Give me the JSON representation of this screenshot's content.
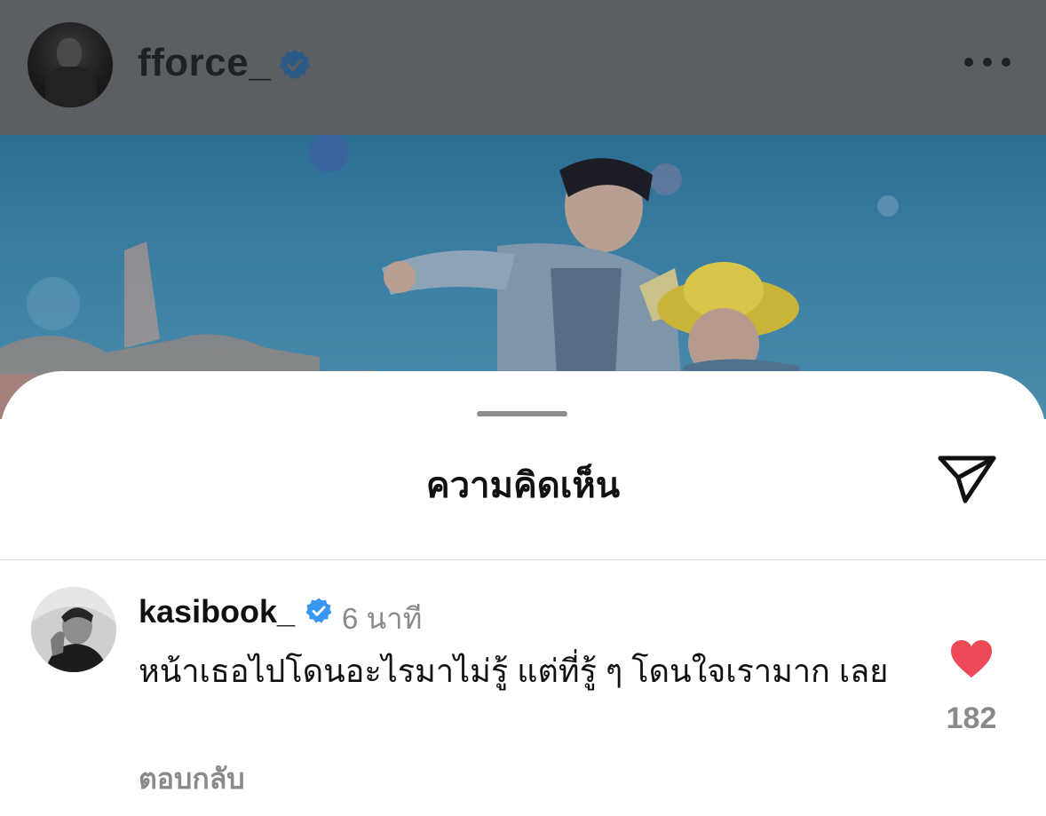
{
  "post": {
    "username": "fforce_",
    "verified": true,
    "more_icon": "more-horizontal-icon"
  },
  "sheet": {
    "title": "ความคิดเห็น",
    "share_icon": "send-icon"
  },
  "comment": {
    "username": "kasibook_",
    "verified": true,
    "time": "6 นาที",
    "text": "หน้าเธอไปโดนอะไรมาไม่รู้ แต่ที่รู้ ๆ โดนใจเรามาก เลย",
    "reply_label": "ตอบกลับ",
    "likes": "182",
    "liked": true
  },
  "colors": {
    "verified_blue": "#3897f0",
    "like_red": "#ed4956",
    "header_dim": "#5b5e62"
  }
}
